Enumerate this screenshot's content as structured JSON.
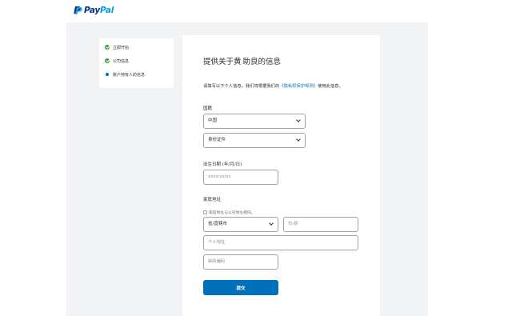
{
  "brand": {
    "pay": "Pay",
    "pal": "Pal"
  },
  "steps": [
    {
      "label": "立即开始",
      "status": "done"
    },
    {
      "label": "公司信息",
      "status": "done"
    },
    {
      "label": "账户持有人的信息",
      "status": "current"
    }
  ],
  "form": {
    "title_part1": "提供关于黄",
    "title_part2": "助良的信息",
    "intro_before": "请填写以下个人信息。我们将根据我们的",
    "intro_link": "《隐私权保护规则》",
    "intro_after": "使用此信息。",
    "nationality_label": "国籍",
    "nationality_value": "中国",
    "id_type_value": "身份证件",
    "dob_label": "出生日期 (年/月/日)",
    "dob_placeholder": "xxxx/xx/xx",
    "address_label": "家庭地址",
    "same_address_text": "家庭地址与公司地址相同。",
    "province_value": "省/直辖市",
    "city_placeholder": "市/县",
    "street_placeholder": "个人地址",
    "postal_placeholder": "邮政编码",
    "submit_label": "提交"
  },
  "colors": {
    "accent": "#0070ba",
    "success": "#3e9a3a",
    "paypal_dark": "#003087",
    "paypal_light": "#009cde"
  }
}
